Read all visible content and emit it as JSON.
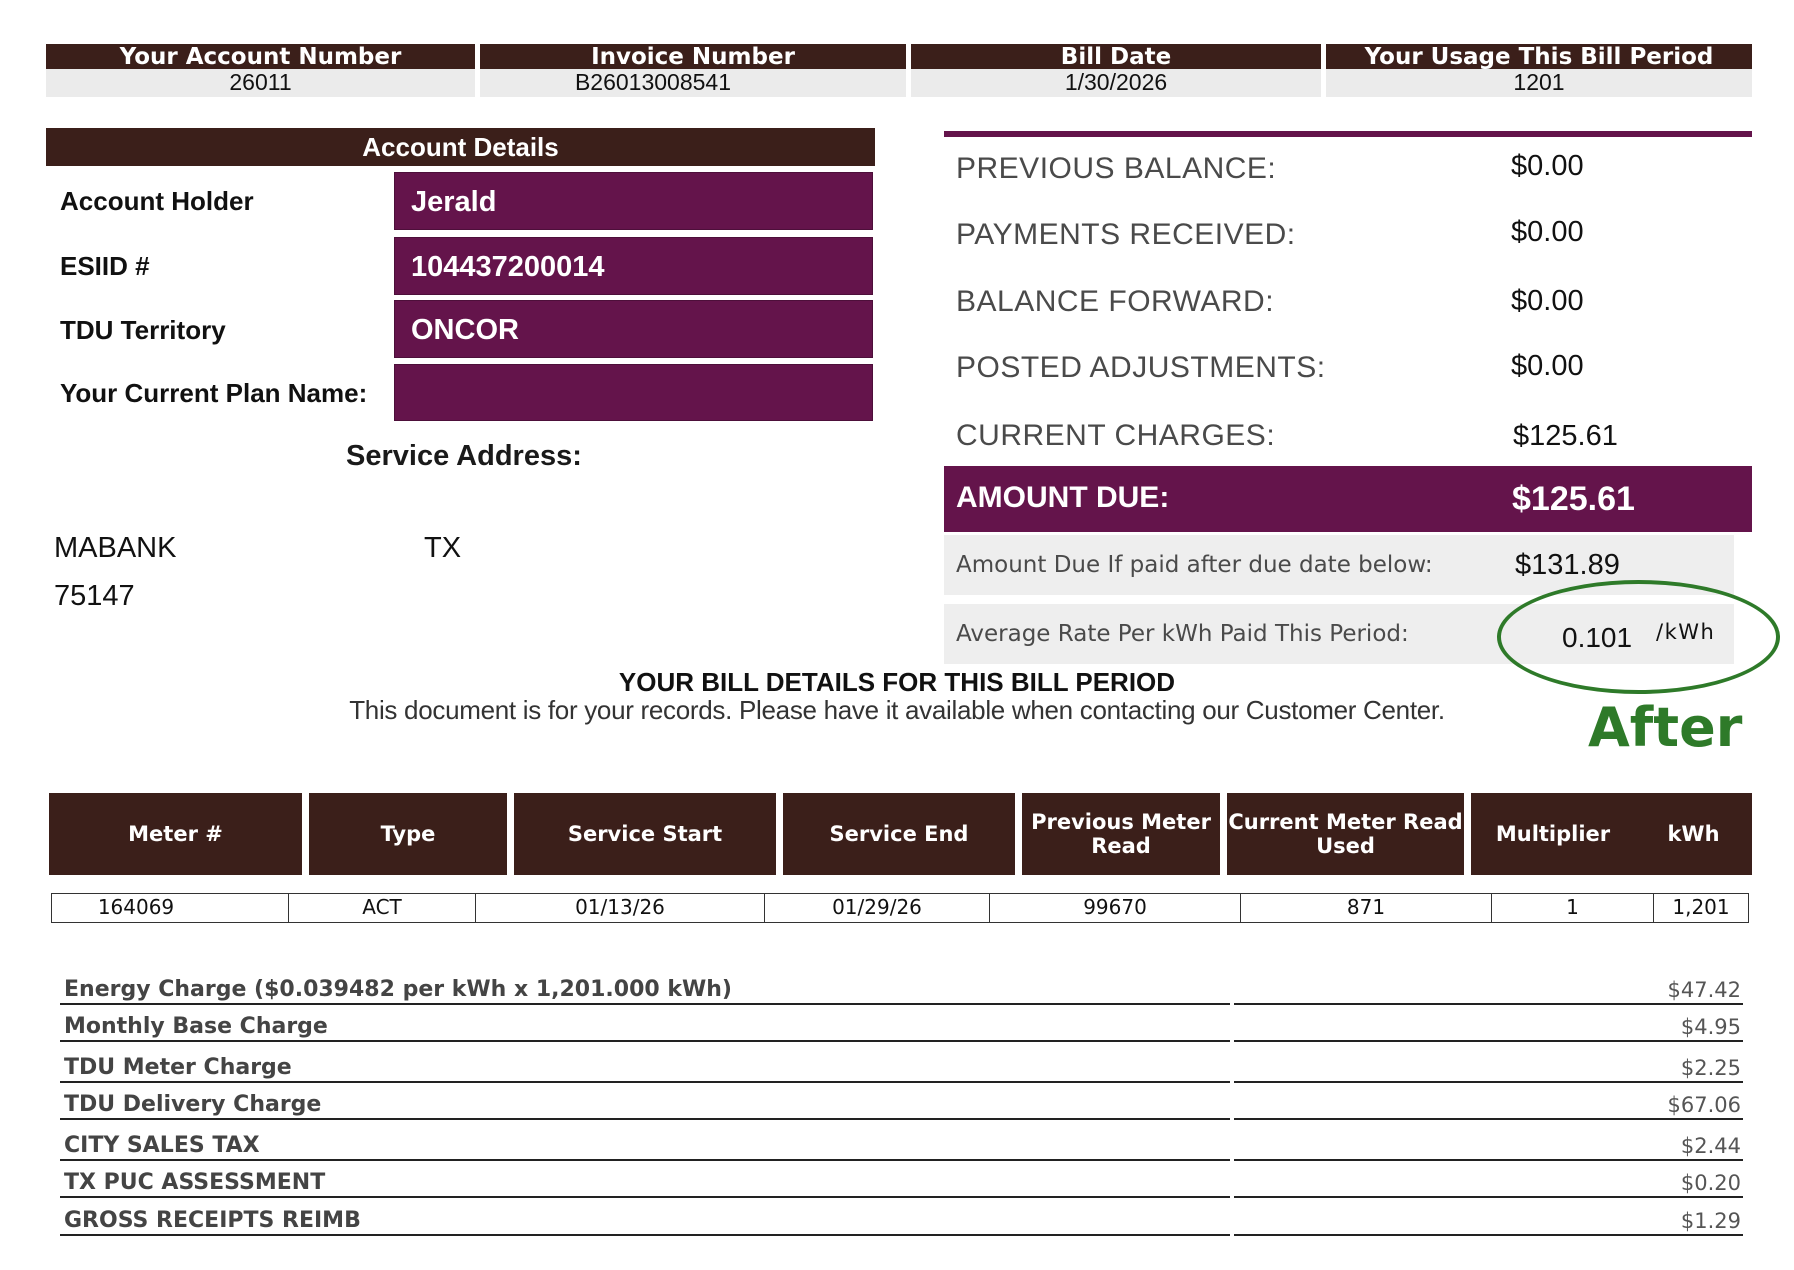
{
  "header": {
    "account_number_label": "Your Account Number",
    "account_number": "26011",
    "invoice_number_label": "Invoice Number",
    "invoice_number": "B26013008541",
    "bill_date_label": "Bill Date",
    "bill_date": "1/30/2026",
    "usage_label": "Your Usage This Bill Period",
    "usage": "1201"
  },
  "account_details": {
    "title": "Account Details",
    "holder_label": "Account Holder",
    "holder": "Jerald",
    "esiid_label": "ESIID #",
    "esiid": "104437200014",
    "tdu_label": "TDU Territory",
    "tdu": "ONCOR",
    "plan_label": "Your Current Plan Name:",
    "plan": ""
  },
  "service_address": {
    "label": "Service Address:",
    "city": "MABANK",
    "state": "TX",
    "zip": "75147"
  },
  "balance": {
    "previous_label": "PREVIOUS BALANCE:",
    "previous": "$0.00",
    "payments_label": "PAYMENTS RECEIVED:",
    "payments": "$0.00",
    "forward_label": "BALANCE FORWARD:",
    "forward": "$0.00",
    "adjustments_label": "POSTED ADJUSTMENTS:",
    "adjustments": "$0.00",
    "current_label": "CURRENT CHARGES:",
    "current": "$125.61",
    "amount_due_label": "AMOUNT DUE:",
    "amount_due": "$125.61",
    "late_label": "Amount Due If paid after due date below:",
    "late": "$131.89",
    "avg_rate_label": "Average Rate Per kWh Paid This Period:",
    "avg_rate": "0.101",
    "avg_rate_unit": "/kWh"
  },
  "annotation": {
    "text": "After",
    "color": "#2e7a29"
  },
  "bill_details": {
    "title": "YOUR BILL DETAILS FOR THIS BILL PERIOD",
    "subtitle": "This document is for your records. Please have it available when contacting our Customer Center."
  },
  "meter_table": {
    "headers": [
      "Meter #",
      "Type",
      "Service Start",
      "Service End",
      "Previous Meter Read",
      "Current Meter Read Used",
      "Multiplier",
      "kWh"
    ],
    "row": [
      "164069",
      "ACT",
      "01/13/26",
      "01/29/26",
      "99670",
      "871",
      "1",
      "1,201"
    ]
  },
  "charges": [
    {
      "label": "Energy Charge ($0.039482 per kWh x 1,201.000 kWh)",
      "amount": "$47.42"
    },
    {
      "label": "Monthly Base Charge",
      "amount": "$4.95"
    },
    {
      "label": "TDU Meter Charge",
      "amount": "$2.25"
    },
    {
      "label": "TDU Delivery Charge",
      "amount": "$67.06"
    },
    {
      "label": "CITY SALES TAX",
      "amount": "$2.44"
    },
    {
      "label": "TX PUC ASSESSMENT",
      "amount": "$0.20"
    },
    {
      "label": "GROSS RECEIPTS REIMB",
      "amount": "$1.29"
    }
  ],
  "colors": {
    "dark_brown": "#3b1f1a",
    "plum": "#64144b",
    "annotation_green": "#2e7a29"
  }
}
